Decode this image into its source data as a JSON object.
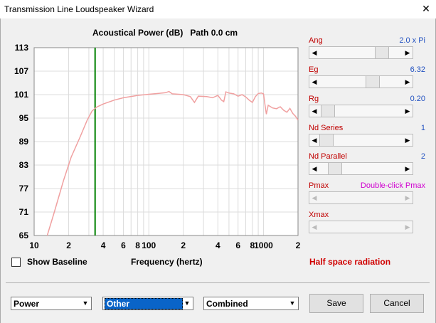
{
  "window": {
    "title": "Transmission Line Loudspeaker Wizard",
    "close_glyph": "✕"
  },
  "chart_title": "Acoustical Power (dB)   Path 0.0 cm",
  "chart_data": {
    "type": "line",
    "title": "Acoustical Power (dB)   Path 0.0 cm",
    "xlabel": "Frequency (hertz)",
    "ylabel": "",
    "xscale": "log",
    "xlim": [
      10,
      2000
    ],
    "ylim": [
      65,
      113
    ],
    "yticks": [
      65,
      71,
      77,
      83,
      89,
      95,
      101,
      107,
      113
    ],
    "xtick_labels": [
      {
        "f": 10,
        "label": "10"
      },
      {
        "f": 20,
        "label": "2"
      },
      {
        "f": 40,
        "label": "4"
      },
      {
        "f": 60,
        "label": "6"
      },
      {
        "f": 80,
        "label": "8"
      },
      {
        "f": 100,
        "label": "100"
      },
      {
        "f": 200,
        "label": "2"
      },
      {
        "f": 400,
        "label": "4"
      },
      {
        "f": 600,
        "label": "6"
      },
      {
        "f": 800,
        "label": "8"
      },
      {
        "f": 1000,
        "label": "1000"
      },
      {
        "f": 2000,
        "label": "2"
      }
    ],
    "grid": true,
    "marker_frequency": 34,
    "marker_color": "#008000",
    "series": [
      {
        "color": "#f0a0a0",
        "points": [
          [
            13,
            65
          ],
          [
            15,
            71
          ],
          [
            18,
            79
          ],
          [
            21,
            85
          ],
          [
            25,
            90
          ],
          [
            29,
            94.5
          ],
          [
            32,
            96.8
          ],
          [
            35,
            97.8
          ],
          [
            40,
            98.6
          ],
          [
            50,
            99.6
          ],
          [
            60,
            100.2
          ],
          [
            80,
            100.8
          ],
          [
            100,
            101.1
          ],
          [
            120,
            101.3
          ],
          [
            140,
            101.5
          ],
          [
            150,
            101.8
          ],
          [
            160,
            101.2
          ],
          [
            200,
            101.0
          ],
          [
            230,
            100.5
          ],
          [
            250,
            99.0
          ],
          [
            270,
            100.6
          ],
          [
            320,
            100.5
          ],
          [
            360,
            100.2
          ],
          [
            400,
            100.8
          ],
          [
            430,
            99.6
          ],
          [
            450,
            99.2
          ],
          [
            470,
            101.7
          ],
          [
            500,
            101.4
          ],
          [
            550,
            101.2
          ],
          [
            600,
            100.6
          ],
          [
            650,
            101.0
          ],
          [
            700,
            100.4
          ],
          [
            750,
            99.6
          ],
          [
            800,
            99.0
          ],
          [
            850,
            100.5
          ],
          [
            900,
            101.3
          ],
          [
            960,
            101.4
          ],
          [
            1000,
            101.2
          ],
          [
            1030,
            98.5
          ],
          [
            1060,
            96.0
          ],
          [
            1100,
            98.3
          ],
          [
            1200,
            97.6
          ],
          [
            1300,
            97.4
          ],
          [
            1400,
            97.9
          ],
          [
            1500,
            97.0
          ],
          [
            1600,
            96.5
          ],
          [
            1700,
            97.5
          ],
          [
            1800,
            96.2
          ],
          [
            1900,
            95.5
          ],
          [
            2000,
            94.5
          ]
        ]
      }
    ]
  },
  "controls": [
    {
      "key": "ang",
      "label": "Ang",
      "value": "2.0 x Pi",
      "position": 0.8,
      "enabled": true,
      "value_color": "blue"
    },
    {
      "key": "eg",
      "label": "Eg",
      "value": "6.32",
      "position": 0.67,
      "enabled": true,
      "value_color": "blue"
    },
    {
      "key": "rg",
      "label": "Rg",
      "value": "0.20",
      "position": 0.02,
      "enabled": true,
      "value_color": "blue"
    },
    {
      "key": "nd-series",
      "label": "Nd  Series",
      "value": "1",
      "position": 0.0,
      "enabled": true,
      "value_color": "blue"
    },
    {
      "key": "nd-parallel",
      "label": "Nd  Parallel",
      "value": "2",
      "position": 0.12,
      "enabled": true,
      "value_color": "blue"
    },
    {
      "key": "pmax",
      "label": "Pmax",
      "value": "Double-click Pmax",
      "position": null,
      "enabled": false,
      "value_color": "magenta"
    },
    {
      "key": "xmax",
      "label": "Xmax",
      "value": "",
      "position": null,
      "enabled": false,
      "value_color": "blue"
    }
  ],
  "show_baseline": {
    "label": "Show Baseline",
    "checked": false
  },
  "frequency_label": "Frequency (hertz)",
  "radiation_label": "Half space radiation",
  "dropdowns": {
    "plot": "Power",
    "type": "Other",
    "combine": "Combined"
  },
  "buttons": {
    "save": "Save",
    "cancel": "Cancel"
  }
}
